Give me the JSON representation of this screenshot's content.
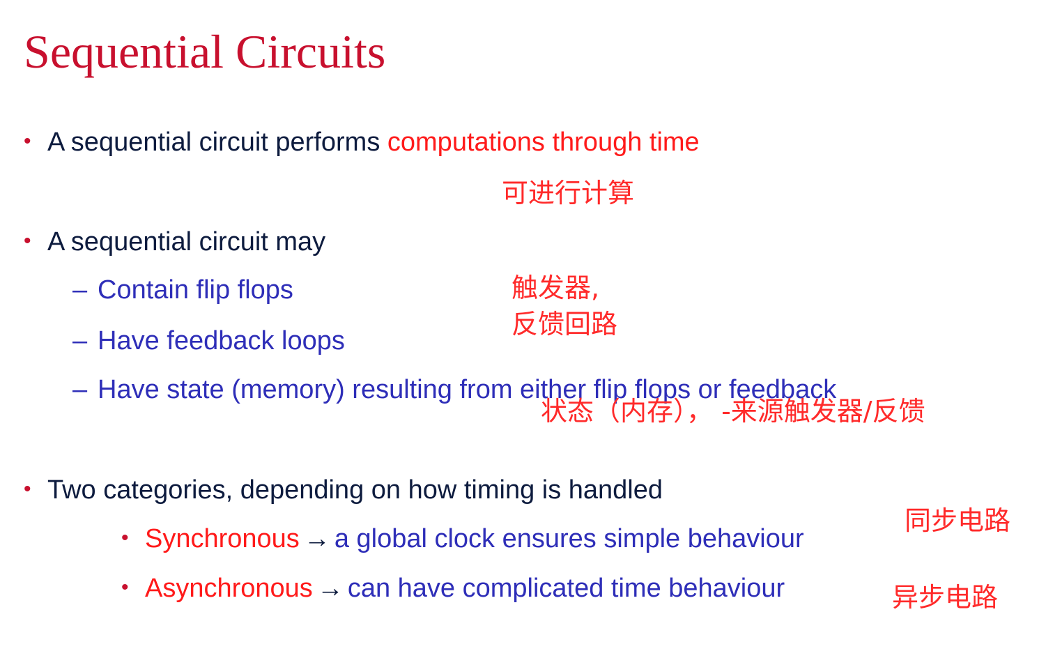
{
  "colors": {
    "title": "#c8102e",
    "bullet": "#c8102e",
    "main_text": "#0d1b3e",
    "sub_text": "#2e2eb8",
    "highlight": "#ff1a1a",
    "annotation": "#ff2a2a"
  },
  "slide": {
    "title": "Sequential Circuits",
    "bullets": [
      {
        "marker": "•",
        "text": "A sequential circuit performs ",
        "highlight": "computations through time"
      },
      {
        "marker": "•",
        "text": "A sequential circuit may",
        "subitems": [
          {
            "marker": "–",
            "text": "Contain flip flops"
          },
          {
            "marker": "–",
            "text": "Have feedback loops"
          },
          {
            "marker": "–",
            "text": "Have state (memory) resulting from either flip flops or feedback"
          }
        ]
      },
      {
        "marker": "•",
        "text": "Two categories, depending on how timing is handled",
        "subitems": [
          {
            "marker": "•",
            "term": "Synchronous",
            "arrow": "→",
            "text": "a global clock ensures simple behaviour"
          },
          {
            "marker": "•",
            "term": "Asynchronous",
            "arrow": "→",
            "text": "can have complicated time behaviour"
          }
        ]
      }
    ]
  },
  "annotations": {
    "computation": "可进行计算",
    "flipflop": "触发器,",
    "feedback": "反馈回路",
    "state": "状态（内存）， -来源触发器/反馈",
    "synchronous": "同步电路",
    "asynchronous": "异步电路"
  }
}
